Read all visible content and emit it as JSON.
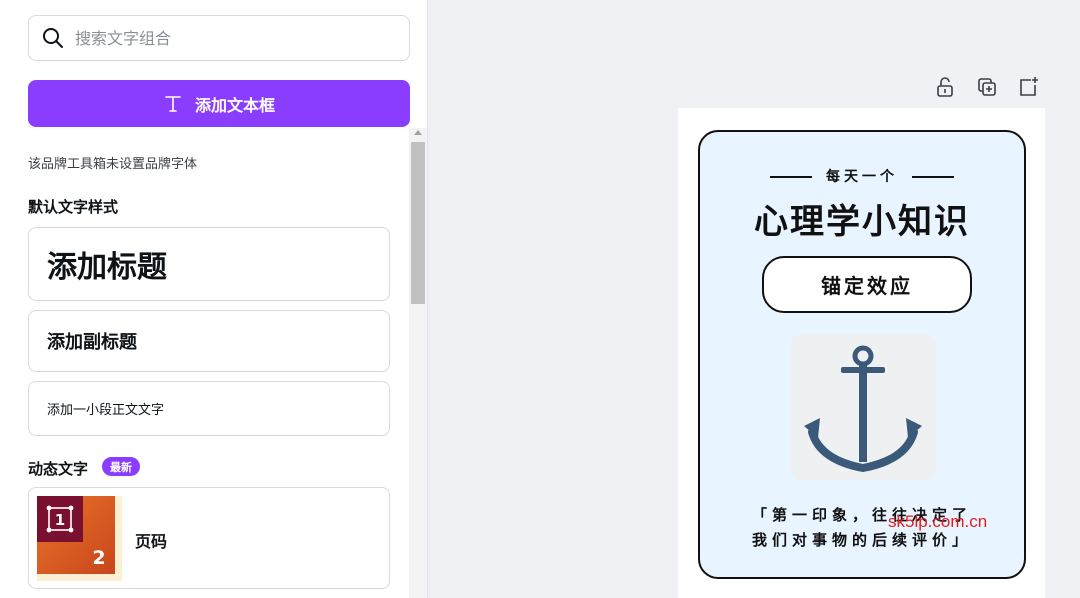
{
  "search": {
    "placeholder": "搜索文字组合"
  },
  "add_textbox_button": {
    "label": "添加文本框"
  },
  "brand_note": "该品牌工具箱未设置品牌字体",
  "default_styles": {
    "title": "默认文字样式",
    "items": [
      {
        "label": "添加标题"
      },
      {
        "label": "添加副标题"
      },
      {
        "label": "添加一小段正文文字"
      }
    ]
  },
  "dynamic_text": {
    "title": "动态文字",
    "badge": "最新",
    "items": [
      {
        "label": "页码",
        "thumb_digits": [
          "1",
          "2"
        ]
      }
    ]
  },
  "toolbar": {
    "icons": [
      "unlock-icon",
      "duplicate-icon",
      "add-page-icon"
    ]
  },
  "poster": {
    "small_title": "每天一个",
    "title": "心理学小知识",
    "pill": "锚定效应",
    "quote_line1": "「第一印象，往往决定了",
    "quote_line2": "我们对事物的后续评价」",
    "background": "#e8f4ff",
    "anchor_color": "#3b5a7a"
  },
  "watermark": "sk5lp.com.cn",
  "colors": {
    "accent": "#8b3dff"
  }
}
